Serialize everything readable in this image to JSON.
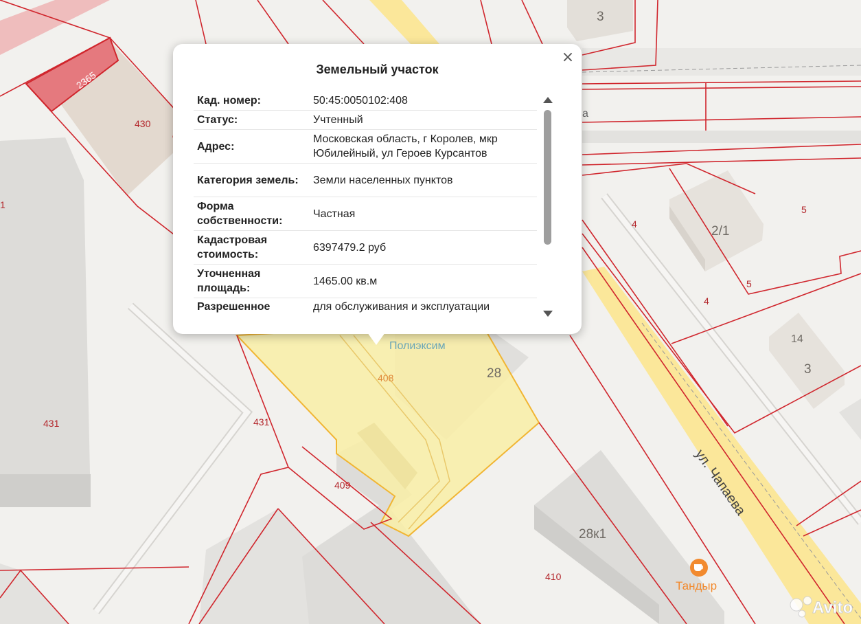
{
  "popup": {
    "title": "Земельный участок",
    "close_symbol": "×",
    "rows": [
      {
        "label": "Кад. номер:",
        "value": "50:45:0050102:408"
      },
      {
        "label": "Статус:",
        "value": "Учтенный"
      },
      {
        "label": "Адрес:",
        "value": "Московская область, г Королев, мкр Юбилейный, ул Героев Курсантов"
      },
      {
        "label": "Категория земель:",
        "value": "Земли населенных пунктов"
      },
      {
        "label": "Форма собственности:",
        "value": "Частная"
      },
      {
        "label": "Кадастровая стоимость:",
        "value": "6397479.2 руб"
      },
      {
        "label": "Уточненная площадь:",
        "value": "1465.00 кв.м"
      },
      {
        "label": "Разрешенное",
        "value": "для обслуживания и эксплуатации"
      }
    ]
  },
  "map": {
    "parcel_labels": [
      "2365",
      "430",
      "431",
      "431",
      "409",
      "408",
      "4",
      "5",
      "5",
      "4",
      "410",
      "1"
    ],
    "house_numbers": [
      "3",
      "2/1",
      "14",
      "3",
      "28",
      "28к1"
    ],
    "street": "ул. Чапаева",
    "street_partial": "a",
    "pois": [
      {
        "name": "Полиэксим",
        "icon": "poi-dot-icon"
      },
      {
        "name": "Тандыр",
        "icon": "cafe-cup-icon"
      }
    ],
    "colors": {
      "cadastral_line": "#d0262d",
      "selected_parcel": "#f9eea6",
      "road": "#fbe79a",
      "building": "#dcdbd8",
      "poi_cafe": "#f28a2e",
      "poi_text": "#6aa6b8"
    }
  },
  "watermark": {
    "text": "Avito",
    "icon": "avito-logo-icon"
  }
}
